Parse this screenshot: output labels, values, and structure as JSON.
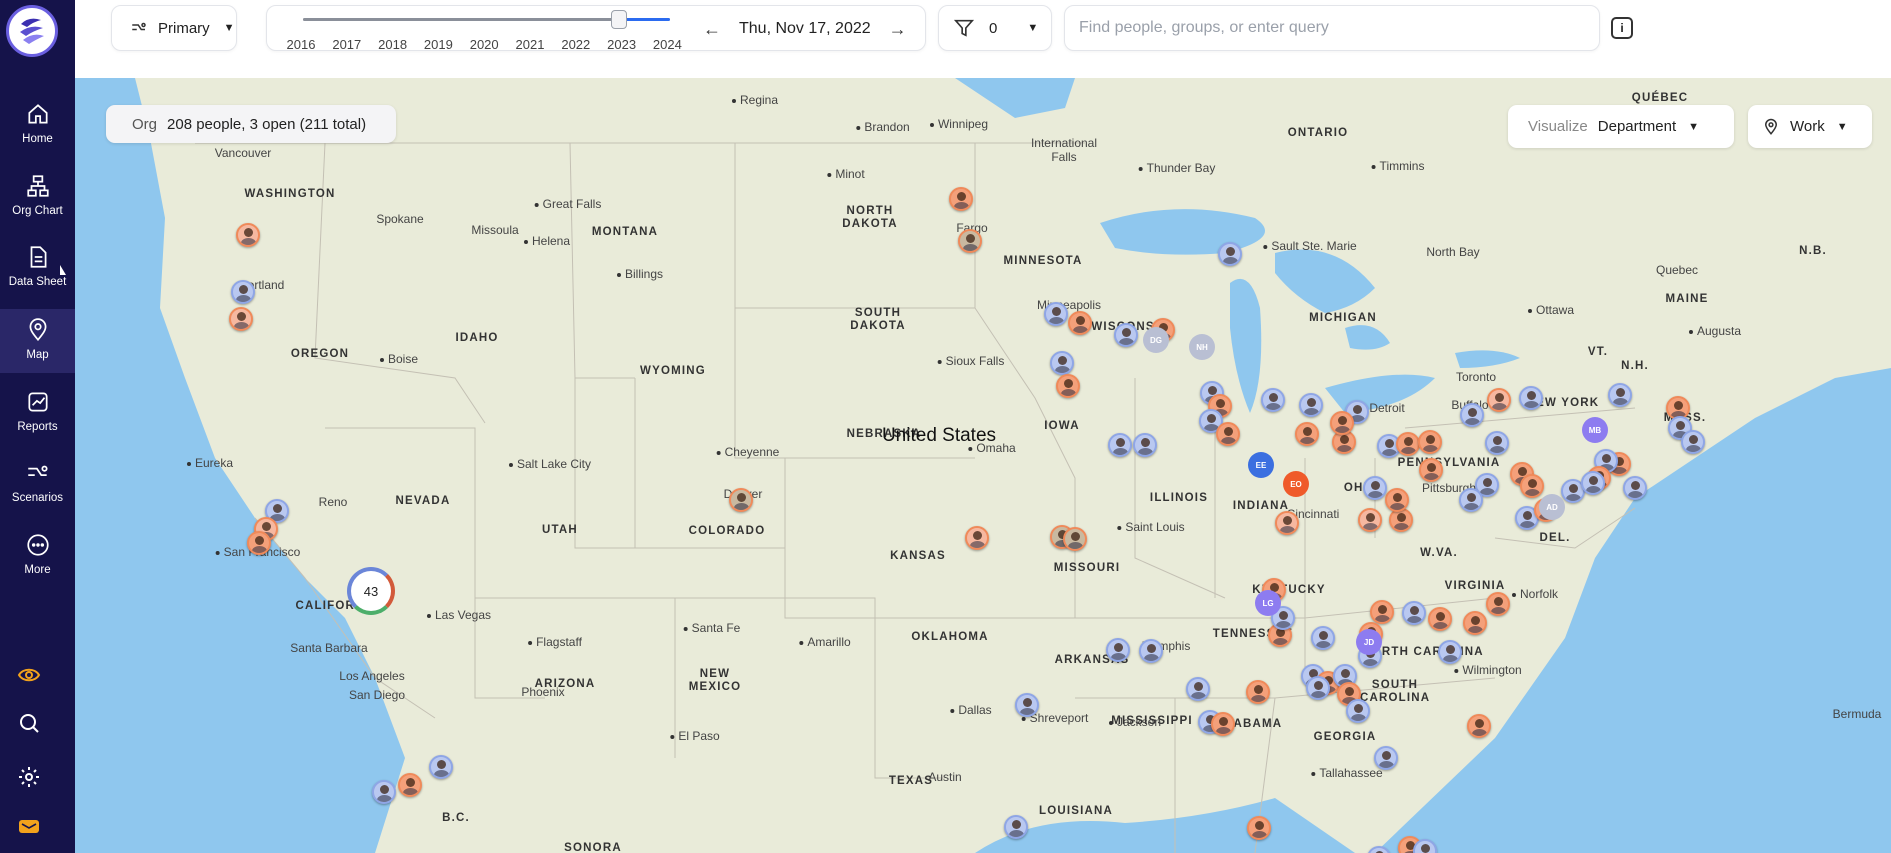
{
  "sidebar": {
    "items": [
      {
        "label": "Home",
        "icon": "home-icon"
      },
      {
        "label": "Org Chart",
        "icon": "org-chart-icon"
      },
      {
        "label": "Data Sheet",
        "icon": "data-sheet-icon"
      },
      {
        "label": "Map",
        "icon": "map-pin-icon"
      },
      {
        "label": "Reports",
        "icon": "reports-icon"
      },
      {
        "label": "Scenarios",
        "icon": "scenarios-icon"
      },
      {
        "label": "More",
        "icon": "more-icon"
      }
    ],
    "active": "Map",
    "bg_color": "#15134a"
  },
  "toolbar": {
    "hierarchy_label": "Primary",
    "timeline_years": [
      "2016",
      "2017",
      "2018",
      "2019",
      "2020",
      "2021",
      "2022",
      "2023",
      "2024"
    ],
    "timeline_position": 0.86,
    "date": "Thu, Nov 17, 2022",
    "filter_count": "0",
    "search_placeholder": "Find people, groups, or enter query",
    "accent_color": "#2b6bf0"
  },
  "map": {
    "org_key": "Org",
    "org_summary": "208 people, 3 open (211 total)",
    "visualize_key": "Visualize",
    "visualize_value": "Department",
    "location_mode": "Work",
    "country_label": "United States",
    "cluster_count": "43",
    "state_labels": [
      "WASHINGTON",
      "MONTANA",
      "NORTH DAKOTA",
      "MINNESOTA",
      "OREGON",
      "IDAHO",
      "SOUTH DAKOTA",
      "WYOMING",
      "WISCONSIN",
      "MICHIGAN",
      "NEW YORK",
      "IOWA",
      "NEBRASKA",
      "NEVADA",
      "UTAH",
      "COLORADO",
      "KANSAS",
      "ILLINOIS",
      "INDIANA",
      "OHIO",
      "PENNSYLVANIA",
      "CALIFORNIA",
      "MISSOURI",
      "KENTUCKY",
      "W.VA.",
      "VIRGINIA",
      "OKLAHOMA",
      "TENNESSEE",
      "NORTH CAROLINA",
      "ARKANSAS",
      "ARIZONA",
      "NEW MEXICO",
      "SOUTH CAROLINA",
      "MISSISSIPPI",
      "ALABAMA",
      "GEORGIA",
      "TEXAS",
      "LOUISIANA",
      "ONTARIO",
      "QUÉBEC",
      "MAINE",
      "VT.",
      "N.H.",
      "MASS.",
      "N.B.",
      "DEL.",
      "B.C.",
      "SONORA"
    ],
    "city_labels": [
      "Regina",
      "Brandon",
      "Winnipeg",
      "Vancouver",
      "International Falls",
      "Thunder Bay",
      "Timmins",
      "Minot",
      "Spokane",
      "Great Falls",
      "Missoula",
      "Helena",
      "Fargo",
      "Sault Ste. Marie",
      "North Bay",
      "Billings",
      "Portland",
      "Minneapolis",
      "Ottawa",
      "Augusta",
      "Boise",
      "Sioux Falls",
      "Toronto",
      "Buffalo",
      "Detroit",
      "Eureka",
      "Salt Lake City",
      "Cheyenne",
      "Omaha",
      "Denver",
      "Pittsburgh",
      "Reno",
      "Cincinnati",
      "San Francisco",
      "Saint Louis",
      "Las Vegas",
      "Norfolk",
      "Santa Barbara",
      "Flagstaff",
      "Santa Fe",
      "Amarillo",
      "Memphis",
      "Wilmington",
      "Los Angeles",
      "San Diego",
      "Phoenix",
      "Dallas",
      "Shreveport",
      "Jackson",
      "El Paso",
      "Austin",
      "Tallahassee",
      "Quebec",
      "Bermuda"
    ],
    "initial_badges": [
      {
        "text": "DG",
        "color": "#b9bfd3"
      },
      {
        "text": "NH",
        "color": "#b9bfd3"
      },
      {
        "text": "EE",
        "color": "#3b6fe0"
      },
      {
        "text": "EO",
        "color": "#ef5a2a"
      },
      {
        "text": "MB",
        "color": "#8d7cf0"
      },
      {
        "text": "AD",
        "color": "#b9bfd3"
      },
      {
        "text": "LG",
        "color": "#8d7cf0"
      },
      {
        "text": "JD",
        "color": "#8d7cf0"
      }
    ]
  }
}
